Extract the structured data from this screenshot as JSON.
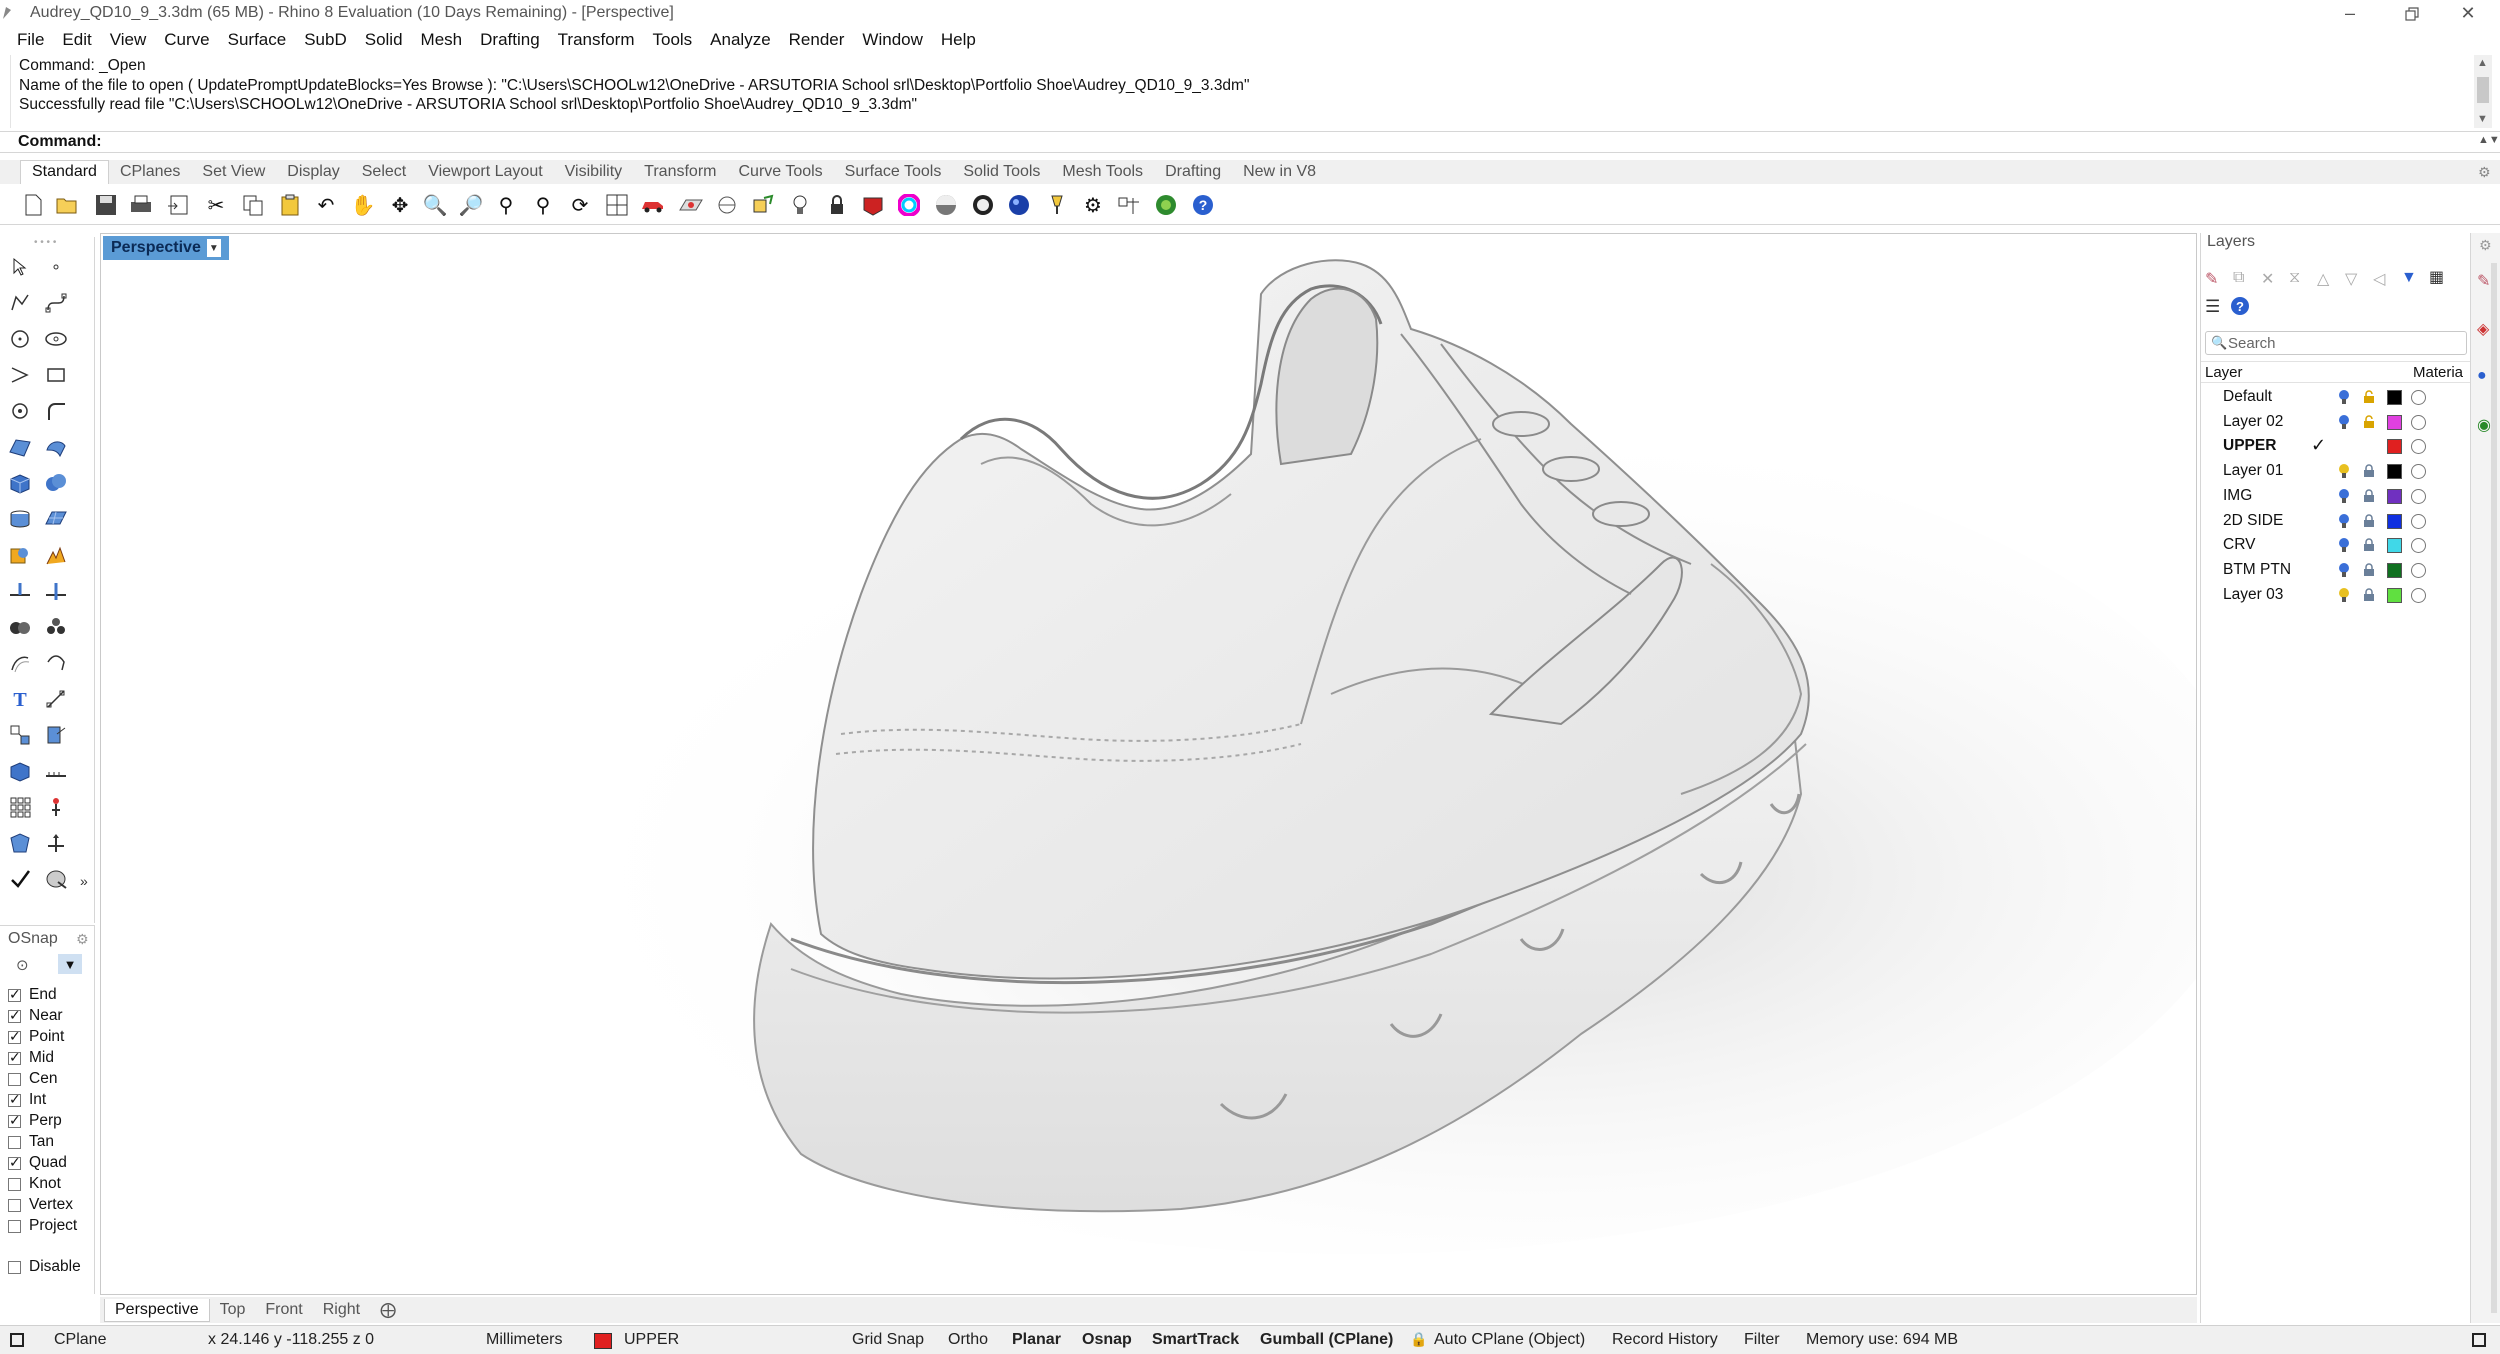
{
  "window": {
    "title": "Audrey_QD10_9_3.3dm (65 MB) - Rhino 8 Evaluation (10 Days Remaining) - [Perspective]"
  },
  "menu": [
    "File",
    "Edit",
    "View",
    "Curve",
    "Surface",
    "SubD",
    "Solid",
    "Mesh",
    "Drafting",
    "Transform",
    "Tools",
    "Analyze",
    "Render",
    "Window",
    "Help"
  ],
  "command_history": [
    "Command: _Open",
    "Name of the file to open ( UpdatePromptUpdateBlocks=Yes  Browse ): \"C:\\Users\\SCHOOLw12\\OneDrive - ARSUTORIA School srl\\Desktop\\Portfolio Shoe\\Audrey_QD10_9_3.3dm\"",
    "Successfully read file \"C:\\Users\\SCHOOLw12\\OneDrive - ARSUTORIA School srl\\Desktop\\Portfolio Shoe\\Audrey_QD10_9_3.3dm\""
  ],
  "command_prompt": "Command:",
  "toolbar_tabs": [
    "Standard",
    "CPlanes",
    "Set View",
    "Display",
    "Select",
    "Viewport Layout",
    "Visibility",
    "Transform",
    "Curve Tools",
    "Surface Tools",
    "Solid Tools",
    "Mesh Tools",
    "Drafting",
    "New in V8"
  ],
  "toolbar_tabs_active": "Standard",
  "toolbar_icons": [
    "new-icon",
    "open-icon",
    "save-icon",
    "print-icon",
    "import-icon",
    "cut-icon",
    "copy-icon",
    "paste-icon",
    "undo-icon",
    "pan-icon",
    "rotate-view-icon",
    "zoom-icon",
    "zoom-window-icon",
    "zoom-extents-icon",
    "zoom-selected-icon",
    "rotate-icon",
    "four-views-icon",
    "car-icon",
    "cplane-icon",
    "circle-cplane-icon",
    "named-views-icon",
    "light-icon",
    "lock-icon",
    "material-icon",
    "color-wheel-icon",
    "rendered-sphere-icon",
    "sphere-icon",
    "sphere-alt-icon",
    "render-sphere-icon",
    "lamp-icon",
    "gear-icon",
    "options-icon",
    "grasshopper-icon",
    "help-icon"
  ],
  "viewport": {
    "active_label": "Perspective"
  },
  "viewport_tabs": [
    "Perspective",
    "Top",
    "Front",
    "Right"
  ],
  "osnap": {
    "title": "OSnap",
    "items": [
      {
        "label": "End",
        "checked": true
      },
      {
        "label": "Near",
        "checked": true
      },
      {
        "label": "Point",
        "checked": true
      },
      {
        "label": "Mid",
        "checked": true
      },
      {
        "label": "Cen",
        "checked": false
      },
      {
        "label": "Int",
        "checked": true
      },
      {
        "label": "Perp",
        "checked": true
      },
      {
        "label": "Tan",
        "checked": false
      },
      {
        "label": "Quad",
        "checked": true
      },
      {
        "label": "Knot",
        "checked": false
      },
      {
        "label": "Vertex",
        "checked": false
      },
      {
        "label": "Project",
        "checked": false
      }
    ],
    "disable_label": "Disable"
  },
  "layers": {
    "title": "Layers",
    "search_placeholder": "Search",
    "col_layer": "Layer",
    "col_material": "Materia",
    "rows": [
      {
        "name": "Default",
        "color": "#000000",
        "current": false,
        "bulb": "#3a6fd8",
        "lock": "open"
      },
      {
        "name": "Layer 02",
        "color": "#e040e0",
        "current": false,
        "bulb": "#3a6fd8",
        "lock": "open"
      },
      {
        "name": "UPPER",
        "color": "#e02020",
        "current": true,
        "bulb": "",
        "lock": ""
      },
      {
        "name": "Layer 01",
        "color": "#000000",
        "current": false,
        "bulb": "#e8c020",
        "lock": "closed"
      },
      {
        "name": "IMG",
        "color": "#7030c0",
        "current": false,
        "bulb": "#3a6fd8",
        "lock": "closed"
      },
      {
        "name": "2D SIDE",
        "color": "#1030e0",
        "current": false,
        "bulb": "#3a6fd8",
        "lock": "closed"
      },
      {
        "name": "CRV",
        "color": "#40d8e8",
        "current": false,
        "bulb": "#3a6fd8",
        "lock": "closed"
      },
      {
        "name": "BTM PTN",
        "color": "#107020",
        "current": false,
        "bulb": "#3a6fd8",
        "lock": "closed"
      },
      {
        "name": "Layer 03",
        "color": "#60e040",
        "current": false,
        "bulb": "#e8c020",
        "lock": "closed"
      }
    ]
  },
  "status": {
    "cplane": "CPlane",
    "coords": "x 24.146  y -118.255  z 0",
    "units": "Millimeters",
    "layer": "UPPER",
    "layer_color": "#e02020",
    "grid_snap": "Grid Snap",
    "ortho": "Ortho",
    "planar": "Planar",
    "osnap": "Osnap",
    "smarttrack": "SmartTrack",
    "gumball": "Gumball (CPlane)",
    "auto_cplane": "Auto CPlane (Object)",
    "record_history": "Record History",
    "filter": "Filter",
    "memory": "Memory use: 694 MB"
  }
}
